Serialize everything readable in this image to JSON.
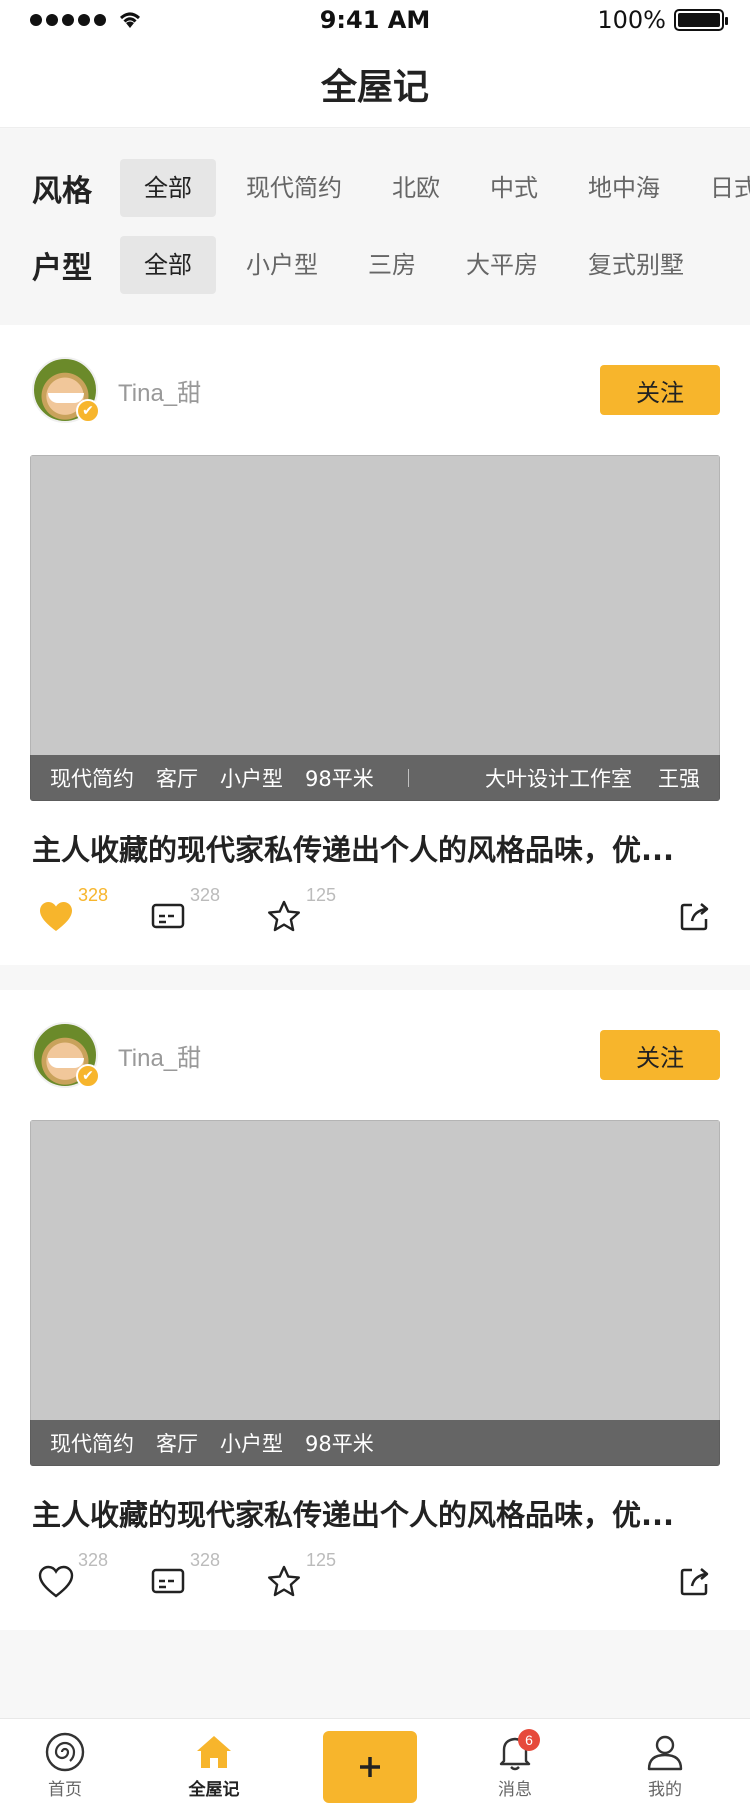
{
  "status_bar": {
    "time": "9:41 AM",
    "battery": "100%"
  },
  "nav": {
    "title": "全屋记"
  },
  "filters": {
    "style": {
      "label": "风格",
      "options": [
        "全部",
        "现代简约",
        "北欧",
        "中式",
        "地中海",
        "日式"
      ],
      "selected": "全部"
    },
    "layout": {
      "label": "户型",
      "options": [
        "全部",
        "小户型",
        "三房",
        "大平房",
        "复式别墅"
      ],
      "selected": "全部"
    }
  },
  "posts": [
    {
      "username": "Tina_甜",
      "follow_label": "关注",
      "tags": [
        "现代简约",
        "客厅",
        "小户型",
        "98平米"
      ],
      "studio": "大叶设计工作室",
      "designer": "王强",
      "title": "主人收藏的现代家私传递出个人的风格品味，优...",
      "likes": "328",
      "comments": "328",
      "favorites": "125",
      "liked": true
    },
    {
      "username": "Tina_甜",
      "follow_label": "关注",
      "tags": [
        "现代简约",
        "客厅",
        "小户型",
        "98平米"
      ],
      "title": "主人收藏的现代家私传递出个人的风格品味，优...",
      "likes": "328",
      "comments": "328",
      "favorites": "125",
      "liked": false
    }
  ],
  "tab_bar": {
    "items": [
      {
        "label": "首页",
        "icon": "home-spiral-icon"
      },
      {
        "label": "全屋记",
        "icon": "house-icon",
        "active": true
      },
      {
        "label": "",
        "icon": "plus-icon"
      },
      {
        "label": "消息",
        "icon": "bell-icon",
        "badge": "6"
      },
      {
        "label": "我的",
        "icon": "person-icon"
      }
    ]
  },
  "colors": {
    "accent": "#f7b52c",
    "badge": "#e64a3b"
  }
}
